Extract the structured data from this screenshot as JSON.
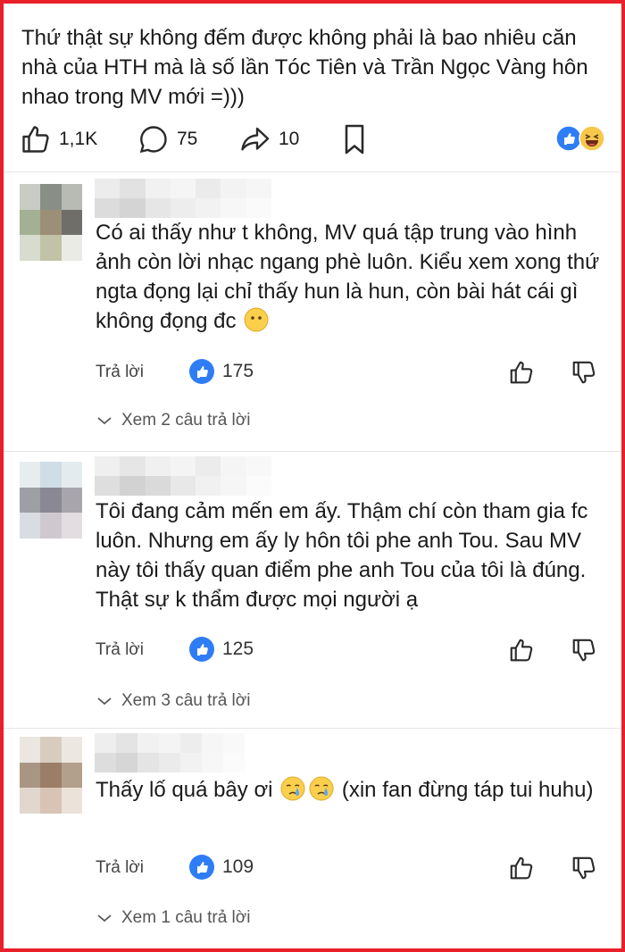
{
  "post": {
    "text": "Thứ thật sự không đếm được không phải là bao nhiêu căn nhà của HTH mà là số lần Tóc Tiên và Trần Ngọc Vàng hôn nhao trong MV mới =)))",
    "likes": "1,1K",
    "comments": "75",
    "shares": "10"
  },
  "comments": [
    {
      "text_a": "Có ai thấy như t không, MV quá tập trung vào hình ảnh còn lời nhạc ngang phè luôn. Kiểu xem xong thứ ngta đọng lại chỉ thấy hun là hun, còn bài hát cái gì không đọng đc",
      "text_b": "",
      "reply_label": "Trả lời",
      "likes": "175",
      "see_replies": "Xem 2 câu trả lời"
    },
    {
      "text_a": "Tôi đang cảm mến em ấy. Thậm chí còn tham gia fc luôn. Nhưng em ấy ly hôn tôi phe anh Tou. Sau MV này tôi thấy quan điểm phe anh Tou của tôi là đúng. Thật sự k thẩm được mọi người ạ",
      "text_b": "",
      "reply_label": "Trả lời",
      "likes": "125",
      "see_replies": "Xem 3 câu trả lời"
    },
    {
      "text_a": "Thấy lố quá bây ơi",
      "text_b": "(xin fan đừng táp tui huhu)",
      "reply_label": "Trả lời",
      "likes": "109",
      "see_replies": "Xem 1 câu trả lời"
    }
  ],
  "colors": {
    "frame": "#e8202a",
    "like_blue": "#2f7df6",
    "icon": "#2a2a2a"
  },
  "icons": [
    "thumb-up-icon",
    "speech-bubble-icon",
    "share-arrow-icon",
    "bookmark-icon",
    "thumb-down-icon",
    "chevron-down-icon"
  ]
}
